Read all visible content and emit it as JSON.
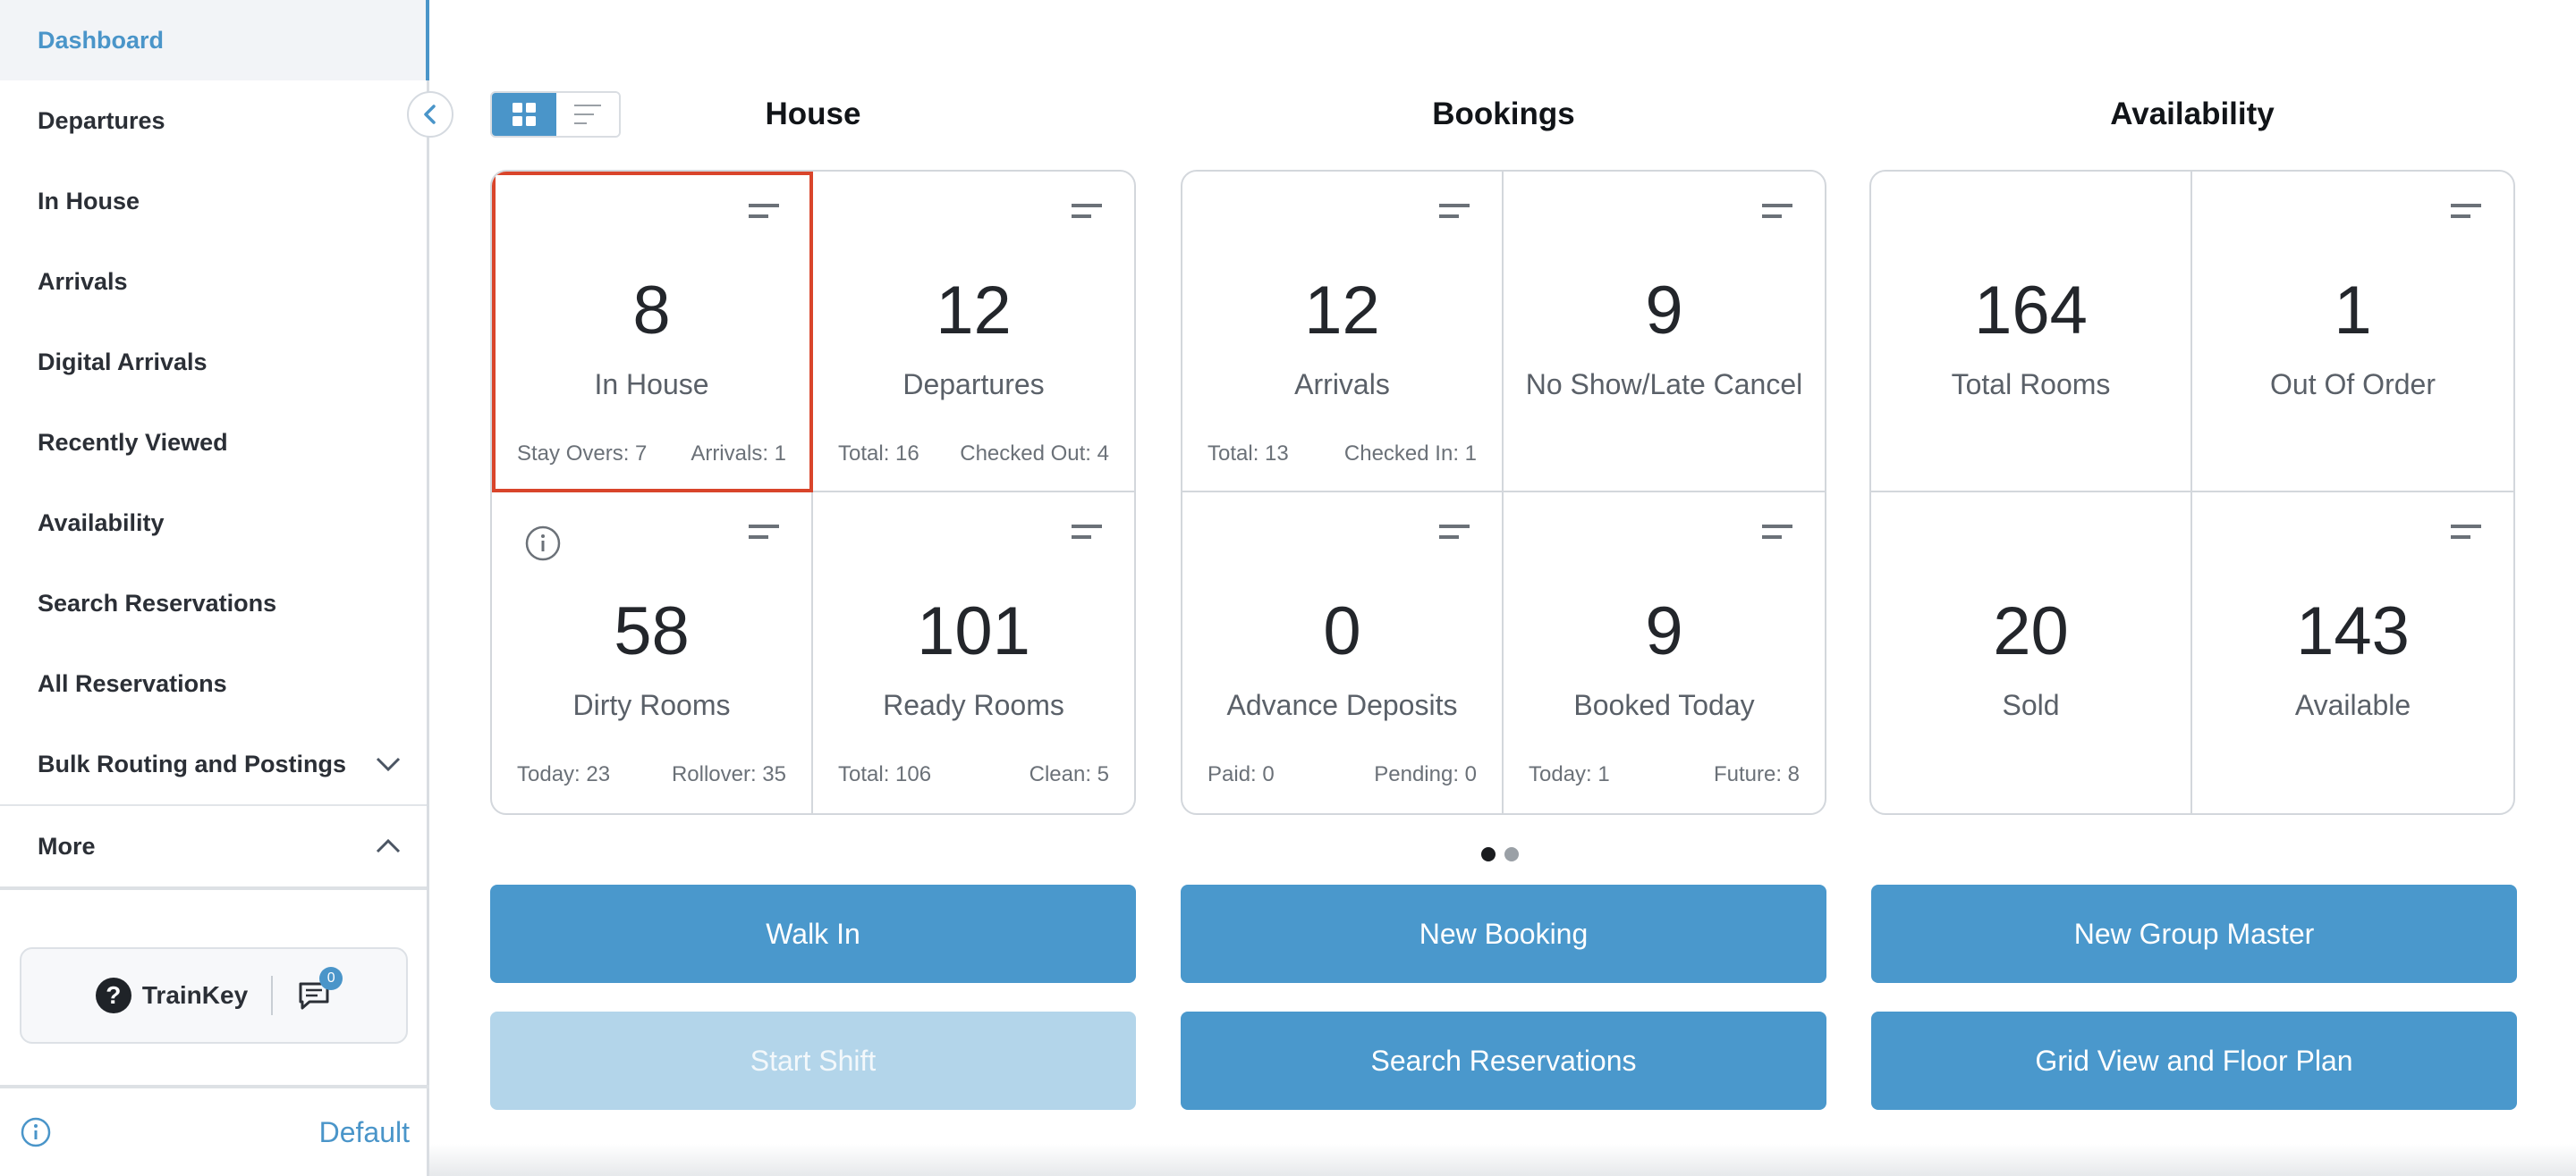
{
  "sidebar": {
    "items": [
      {
        "label": "Dashboard"
      },
      {
        "label": "Departures"
      },
      {
        "label": "In House"
      },
      {
        "label": "Arrivals"
      },
      {
        "label": "Digital Arrivals"
      },
      {
        "label": "Recently Viewed"
      },
      {
        "label": "Availability"
      },
      {
        "label": "Search Reservations"
      },
      {
        "label": "All Reservations"
      },
      {
        "label": "Bulk Routing and Postings"
      },
      {
        "label": "More"
      }
    ],
    "trainkey_label": "TrainKey",
    "message_count": "0",
    "footer_label": "Default"
  },
  "sections": {
    "house": "House",
    "bookings": "Bookings",
    "availability": "Availability"
  },
  "house": {
    "in_house": {
      "value": "8",
      "label": "In House",
      "foot_left": "Stay Overs: 7",
      "foot_right": "Arrivals: 1"
    },
    "departures": {
      "value": "12",
      "label": "Departures",
      "foot_left": "Total: 16",
      "foot_right": "Checked Out: 4"
    },
    "dirty_rooms": {
      "value": "58",
      "label": "Dirty Rooms",
      "foot_left": "Today: 23",
      "foot_right": "Rollover: 35"
    },
    "ready_rooms": {
      "value": "101",
      "label": "Ready Rooms",
      "foot_left": "Total: 106",
      "foot_right": "Clean: 5"
    }
  },
  "bookings": {
    "arrivals": {
      "value": "12",
      "label": "Arrivals",
      "foot_left": "Total: 13",
      "foot_right": "Checked In: 1"
    },
    "no_show": {
      "value": "9",
      "label": "No Show/Late Cancel"
    },
    "advance_deposits": {
      "value": "0",
      "label": "Advance Deposits",
      "foot_left": "Paid: 0",
      "foot_right": "Pending: 0"
    },
    "booked_today": {
      "value": "9",
      "label": "Booked Today",
      "foot_left": "Today: 1",
      "foot_right": "Future: 8"
    }
  },
  "availability": {
    "total_rooms": {
      "value": "164",
      "label": "Total Rooms"
    },
    "out_of_order": {
      "value": "1",
      "label": "Out Of Order"
    },
    "sold": {
      "value": "20",
      "label": "Sold"
    },
    "available": {
      "value": "143",
      "label": "Available"
    }
  },
  "actions": {
    "walk_in": "Walk In",
    "new_booking": "New Booking",
    "new_group_master": "New Group Master",
    "start_shift": "Start Shift",
    "search_reservations": "Search Reservations",
    "grid_view": "Grid View and Floor Plan"
  },
  "colors": {
    "accent": "#4a95c9",
    "selected_outline": "#d9452b",
    "disabled_button": "#b3d5ea"
  }
}
